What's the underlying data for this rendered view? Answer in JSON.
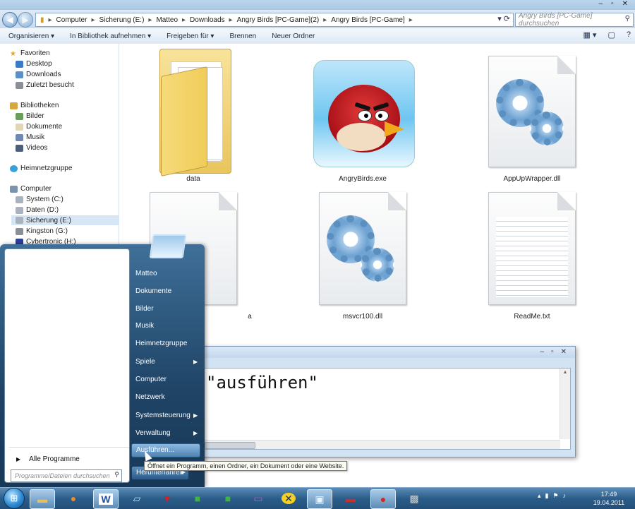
{
  "window": {
    "title": "Angry Birds [PC-Game]"
  },
  "address": {
    "crumbs": [
      "Computer",
      "Sicherung (E:)",
      "Matteo",
      "Downloads",
      "Angry Birds [PC-Game](2)",
      "Angry Birds [PC-Game]"
    ],
    "search_placeholder": "Angry Birds [PC-Game] durchsuchen"
  },
  "toolbar": {
    "organize": "Organisieren ▾",
    "library": "In Bibliothek aufnehmen ▾",
    "share": "Freigeben für ▾",
    "burn": "Brennen",
    "new_folder": "Neuer Ordner"
  },
  "navpane": {
    "favorites": "Favoriten",
    "desktop": "Desktop",
    "downloads": "Downloads",
    "recent": "Zuletzt besucht",
    "libraries": "Bibliotheken",
    "pictures": "Bilder",
    "documents": "Dokumente",
    "music": "Musik",
    "videos": "Videos",
    "homegroup": "Heimnetzgruppe",
    "computer": "Computer",
    "drive_c": "System (C:)",
    "drive_d": "Daten (D:)",
    "drive_e": "Sicherung (E:)",
    "drive_g": "Kingston (G:)",
    "drive_h": "Cybertronic (H:)"
  },
  "files": [
    {
      "name": "data"
    },
    {
      "name": "AngryBirds.exe"
    },
    {
      "name": "AppUpWrapper.dll"
    },
    {
      "name": "a"
    },
    {
      "name": "msvcr100.dll"
    },
    {
      "name": "ReadMe.txt"
    }
  ],
  "editor": {
    "menu": "?",
    "text": "\"ausführen\""
  },
  "startmenu": {
    "right_items": [
      "Matteo",
      "Dokumente",
      "Bilder",
      "Musik",
      "Heimnetzgruppe",
      "Spiele",
      "Computer",
      "Netzwerk",
      "Systemsteuerung",
      "Verwaltung"
    ],
    "run": "Ausführen...",
    "all_programs": "Alle Programme",
    "search_placeholder": "Programme/Dateien durchsuchen",
    "shutdown": "Herunterfahren"
  },
  "tooltip": "Öffnet ein Programm, einen Ordner, ein Dokument oder eine Website.",
  "clock": {
    "time": "17:49",
    "date": "19.04.2011"
  }
}
